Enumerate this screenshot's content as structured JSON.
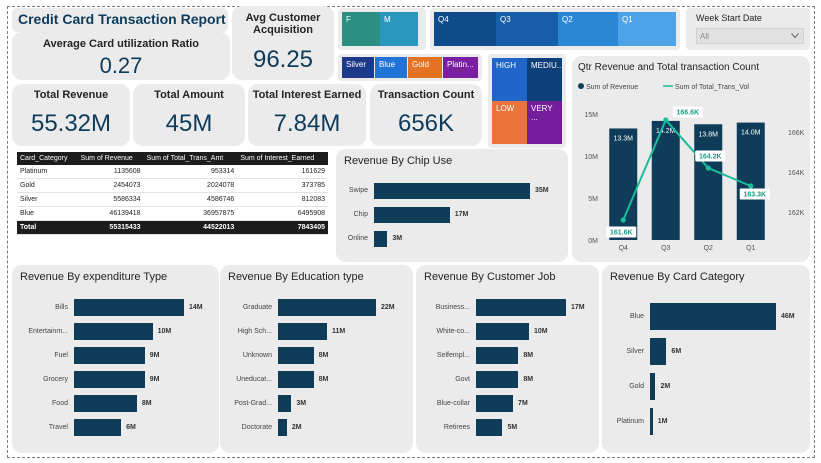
{
  "report_title": "Credit Card Transaction Report",
  "kpis": {
    "avg_customer_acquisition": {
      "label": "Avg Customer Acquisition",
      "value": "96.25"
    },
    "avg_card_utilization": {
      "label": "Average Card utilization Ratio",
      "value": "0.27"
    },
    "total_revenue": {
      "label": "Total Revenue",
      "value": "55.32M"
    },
    "total_amount": {
      "label": "Total Amount",
      "value": "45M"
    },
    "total_interest": {
      "label": "Total Interest Earned",
      "value": "7.84M"
    },
    "transaction_count": {
      "label": "Transaction Count",
      "value": "656K"
    }
  },
  "slicers": {
    "gender": [
      {
        "label": "F",
        "color": "#2b8f84"
      },
      {
        "label": "M",
        "color": "#2a97bf"
      }
    ],
    "quarter": [
      {
        "label": "Q4",
        "color": "#0f4a8a"
      },
      {
        "label": "Q3",
        "color": "#165fa8"
      },
      {
        "label": "Q2",
        "color": "#2a87d6"
      },
      {
        "label": "Q1",
        "color": "#4ea3e6"
      }
    ],
    "card_category": [
      {
        "label": "Silver",
        "color": "#1d3a8a"
      },
      {
        "label": "Blue",
        "color": "#1f74d6"
      },
      {
        "label": "Gold",
        "color": "#e37222"
      },
      {
        "label": "Platin...",
        "color": "#7b1fa2"
      }
    ],
    "income_group": [
      {
        "label": "HIGH",
        "color": "#1f66c8"
      },
      {
        "label": "MEDIU...",
        "color": "#0d3f78"
      },
      {
        "label": "LOW",
        "color": "#e8743b"
      },
      {
        "label": "VERY ...",
        "color": "#751e9c"
      }
    ],
    "week_start": {
      "label": "Week Start Date",
      "value": "All"
    }
  },
  "matrix": {
    "headers": [
      "Card_Category",
      "Sum of Revenue",
      "Sum of Total_Trans_Amt",
      "Sum of Interest_Earned"
    ],
    "rows": [
      [
        "Platinum",
        "1135608",
        "953314",
        "161629"
      ],
      [
        "Gold",
        "2454073",
        "2024078",
        "373785"
      ],
      [
        "Silver",
        "5586334",
        "4586746",
        "812083"
      ],
      [
        "Blue",
        "46139418",
        "36957875",
        "6495908"
      ]
    ],
    "total": [
      "Total",
      "55315433",
      "44522013",
      "7843405"
    ]
  },
  "chip_chart": {
    "title": "Revenue By Chip Use",
    "chart_data": {
      "type": "bar",
      "categories": [
        "Swipe",
        "Chip",
        "Online"
      ],
      "values": [
        35,
        17,
        3
      ],
      "labels": [
        "35M",
        "17M",
        "3M"
      ]
    }
  },
  "combo_chart": {
    "title": "Qtr Revenue and Total transaction Count",
    "legend": [
      "Sum of Revenue",
      "Sum of Total_Trans_Vol"
    ],
    "chart_data": {
      "type": "bar",
      "categories": [
        "Q4",
        "Q3",
        "Q2",
        "Q1"
      ],
      "series": [
        {
          "name": "Sum of Revenue",
          "values": [
            13.3,
            14.2,
            13.8,
            14.0
          ],
          "labels": [
            "13.3M",
            "14.2M",
            "13.8M",
            "14.0M"
          ]
        },
        {
          "name": "Sum of Total_Trans_Vol",
          "values": [
            161.6,
            166.6,
            164.2,
            163.3
          ],
          "labels": [
            "161.6K",
            "166.6K",
            "164.2K",
            "163.3K"
          ]
        }
      ],
      "y_ticks": [
        "0M",
        "5M",
        "10M",
        "15M"
      ],
      "y2_ticks": [
        "162K",
        "164K",
        "166K"
      ],
      "ylim": [
        0,
        15.5
      ],
      "y2lim": [
        160.6,
        167.1
      ]
    }
  },
  "expenditure_chart": {
    "title": "Revenue By expenditure Type",
    "chart_data": {
      "type": "bar",
      "categories": [
        "Bills",
        "Entertainm...",
        "Fuel",
        "Grocery",
        "Food",
        "Travel"
      ],
      "values": [
        14,
        10,
        9,
        9,
        8,
        6
      ],
      "labels": [
        "14M",
        "10M",
        "9M",
        "9M",
        "8M",
        "6M"
      ]
    }
  },
  "education_chart": {
    "title": "Revenue By Education type",
    "chart_data": {
      "type": "bar",
      "categories": [
        "Graduate",
        "High Sch...",
        "Unknown",
        "Uneducat...",
        "Post-Grad...",
        "Doctorate"
      ],
      "values": [
        22,
        11,
        8,
        8,
        3,
        2
      ],
      "labels": [
        "22M",
        "11M",
        "8M",
        "8M",
        "3M",
        "2M"
      ]
    }
  },
  "job_chart": {
    "title": "Revenue By Customer Job",
    "chart_data": {
      "type": "bar",
      "categories": [
        "Business...",
        "White-co...",
        "Selfempl...",
        "Govt",
        "Blue-collar",
        "Retirees"
      ],
      "values": [
        17,
        10,
        8,
        8,
        7,
        5
      ],
      "labels": [
        "17M",
        "10M",
        "8M",
        "8M",
        "7M",
        "5M"
      ]
    }
  },
  "card_chart": {
    "title": "Revenue By Card Category",
    "chart_data": {
      "type": "bar",
      "categories": [
        "Blue",
        "Silver",
        "Gold",
        "Platinum"
      ],
      "values": [
        46,
        6,
        2,
        1
      ],
      "labels": [
        "46M",
        "6M",
        "2M",
        "1M"
      ]
    }
  }
}
